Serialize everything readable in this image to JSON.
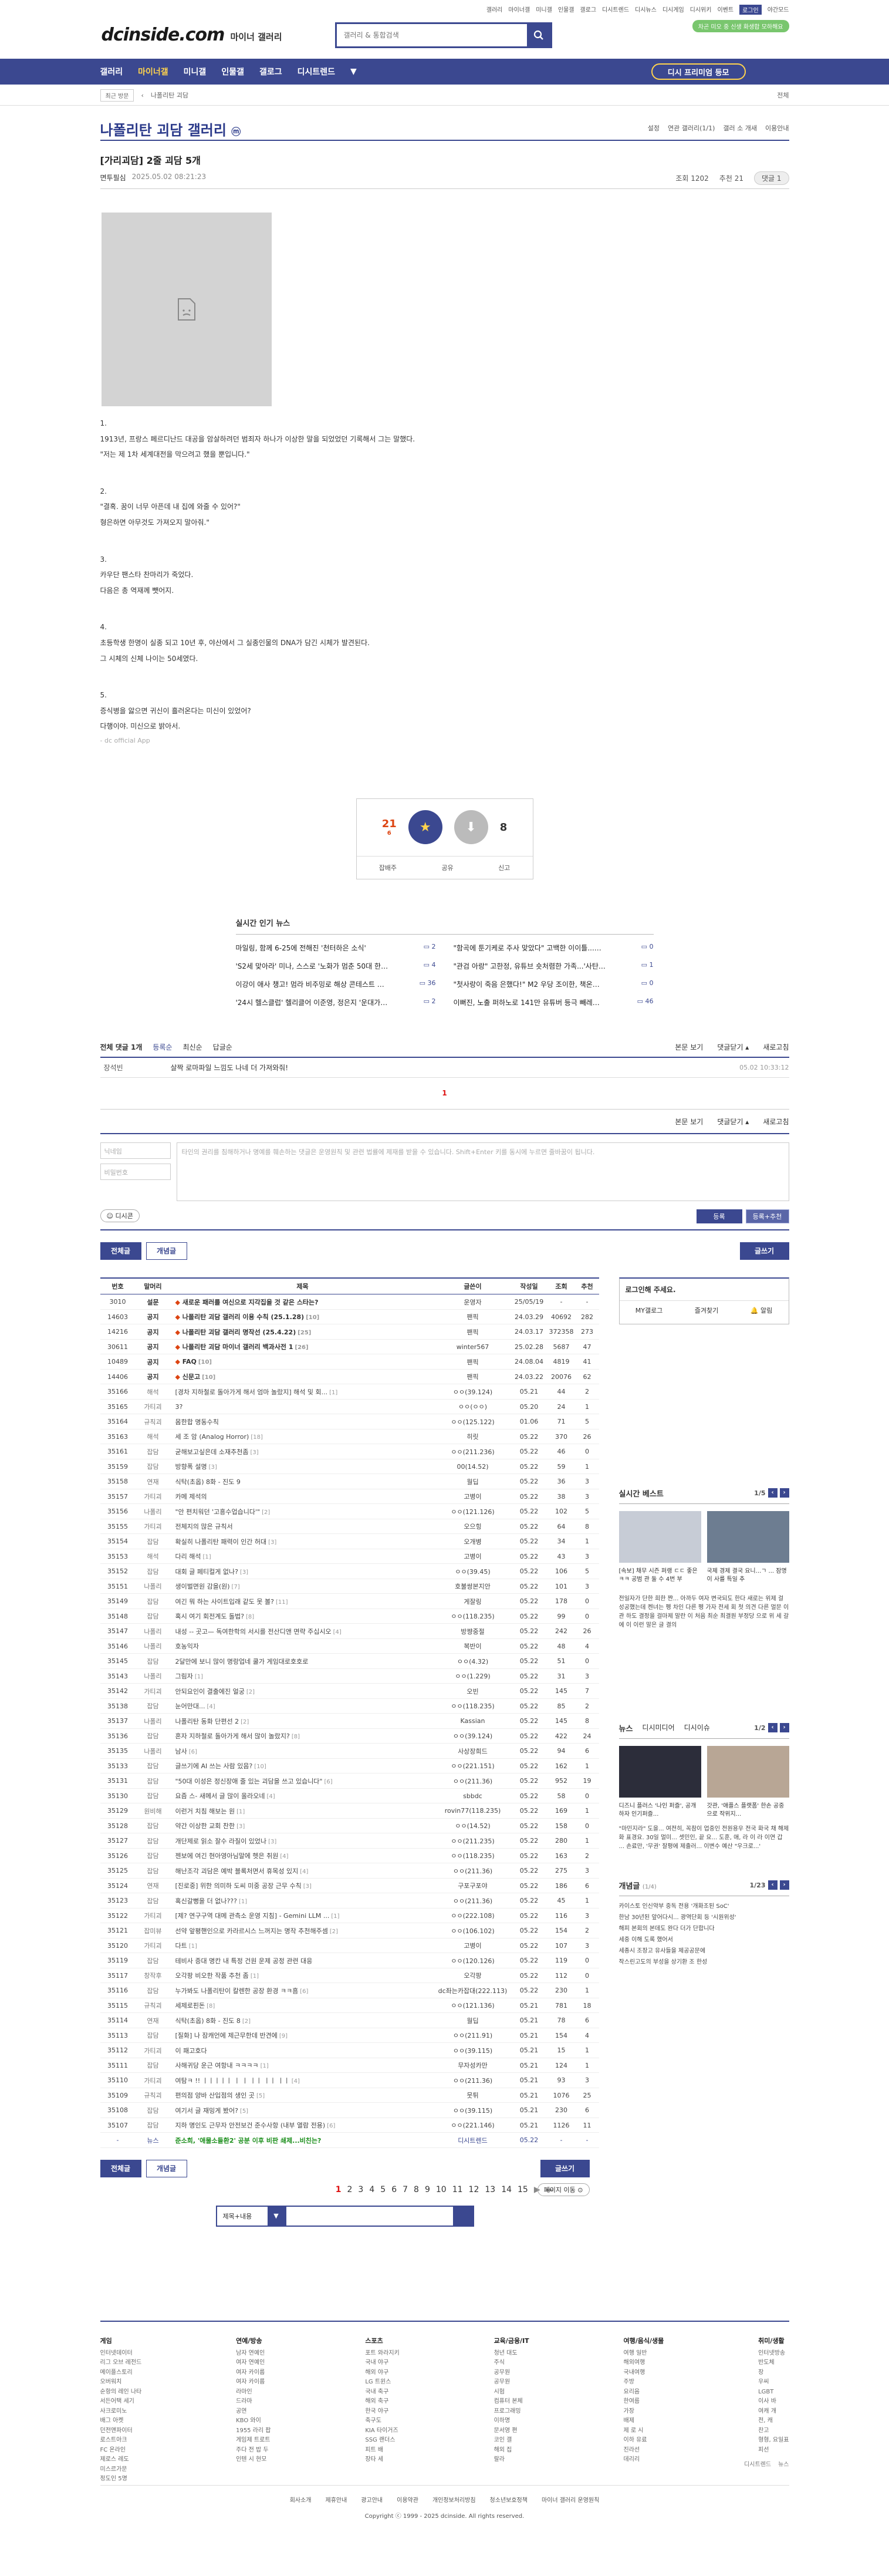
{
  "top": {
    "links": [
      "갤러리",
      "마이너갤",
      "미니갤",
      "인물갤",
      "갤로그",
      "디시트렌드",
      "디시뉴스",
      "디시게임",
      "디시위키",
      "이벤트"
    ],
    "login": "로그인",
    "night": "야간모드",
    "badge": "차곤 미오 중 신생 화생합 모하해요"
  },
  "header": {
    "logo": "dcinside.com",
    "sub": "마이너 갤러리",
    "search_placeholder": "갤러리 & 통합검색"
  },
  "gnb": {
    "items": [
      "갤러리",
      "마이너갤",
      "미니갤",
      "인물갤",
      "갤로그",
      "디시트렌드"
    ],
    "more": "▼",
    "promo": "디시 프리미엄 등모"
  },
  "visit": {
    "recent": "최근 방문",
    "chevron": "‹",
    "current": "나폴리탄 괴담",
    "all": "전체"
  },
  "gallery": {
    "title": "나폴리탄 괴담 갤러리",
    "badge": "ⓜ",
    "tools": [
      "설정",
      "연관 갤러리(1/1)",
      "갤러 소 개새",
      "이용안내"
    ]
  },
  "post": {
    "title": "[가리괴담] 2줄 괴담 5개",
    "writer": "면투필심",
    "date": "2025.05.02 08:21:23",
    "views": "조회 1202",
    "rec": "추천 21",
    "comments": "댓글 1"
  },
  "body": [
    [
      "1.",
      "1913년, 프랑스 페르디난드 대공을 암살하려던 범죄자 하나가 이상한 말을 되었었던 기록해서 그는 말했다.",
      "\"저는 제 1차 세계대전을 막으려고 했을 뿐입니다.\""
    ],
    [
      "2.",
      "\"결혹. 꿈이 너무 아픈데 내 집에 와줄 수 있어?\"",
      "형은하면 아무것도 가져오지 말아줘.\""
    ],
    [
      "3.",
      "카우단 팬스타 찬마리가 죽었다.",
      "다음은 총 역재께 뺏어지."
    ],
    [
      "4.",
      "초등학생 한명이 실종 되고 10년 후, 야산에서 그 실종인물의 DNA가 담긴 시체가 발견된다.",
      "그 시체의 신체 나이는 50세였다."
    ],
    [
      "5.",
      "증식병을 앓으면 귀신이 흘러온다는 미신이 있었어?",
      "다행이야. 미신으로 밝아서."
    ]
  ],
  "dcapp": "- dc official App",
  "recommend": {
    "up": "21",
    "up_sub": "6",
    "up_label": "개념",
    "down": "8",
    "share": "공유",
    "report": "신고",
    "copy": "잡배주"
  },
  "popular": {
    "title": "실시간 인기 뉴스",
    "items": [
      {
        "t": "마일링, 함께 6-25에 전해진 '천터하은 소식'",
        "n": "2"
      },
      {
        "t": "\"함곡에 툰기케로 주사 맞았다\" 고백한 이이틀...달라진 ...",
        "n": "0"
      },
      {
        "t": "'S2세 맞아라' 미나, 스스로 '노화가 멈춘 50대 한국인 여...",
        "n": "4"
      },
      {
        "t": "\"관검 아랑\" 고한정, 유튜브 숏처렴한 가족...'사탄살'에 새...",
        "n": "1"
      },
      {
        "t": "이강이 애사 챙고! 멈라 비주밍로 해상 콘테스트 출용...",
        "n": "36"
      },
      {
        "t": "\"첫사랑이 죽음 은했다!\" M2 우당 조이한, 책온통 추챗...",
        "n": "0"
      },
      {
        "t": "'24시 헬스클럽' 헬리클어 이준영, 정은지 '운대가 귀에 ...",
        "n": "2"
      },
      {
        "t": "이뻐진, 노출 퍼하노로 141만 유튜버 등극 빼레도는 그...",
        "n": "46"
      }
    ]
  },
  "comments": {
    "all": "전체 댓글 1개",
    "order": [
      "등록순",
      "최신순",
      "답글순"
    ],
    "right": [
      "본문 보기",
      "댓글닫기 ▴",
      "새로고침"
    ],
    "item": {
      "name": "장석빈",
      "text": "살짝 로마파일 느낌도 나네 더 가져와줘!",
      "date": "05.02 10:33:12"
    },
    "page": "1",
    "name_ph": "닉네임",
    "pw_ph": "비밀번호",
    "ta_ph": "타인의 권리를 침해하거나 명예를 훼손하는 댓글은 운영원칙 및 관련 법률에 제재를 받을 수 있습니다. Shift+Enter 키를 동시에 누르면 줄바꿈이 됩니다.",
    "dccon": "디시콘",
    "submit": "등록",
    "submit2": "등록+추천"
  },
  "list": {
    "tabs": [
      "전체글",
      "개념글"
    ],
    "write": "글쓰기",
    "headers": [
      "번호",
      "말머리",
      "제목",
      "글쓴이",
      "작성일",
      "조회",
      "추천"
    ],
    "rows": [
      [
        "3010",
        "설문",
        "새로운 패러를 여신으로 지각집을 것 같은 스타는?",
        "운영자",
        "25/05/19",
        "-",
        "-",
        "notice",
        ""
      ],
      [
        "14603",
        "공지",
        "나폴리탄 괴담 갤러리 이용 수칙 (25.1.28)",
        "팬픽",
        "24.03.29",
        "40692",
        "282",
        "notice",
        "[10]"
      ],
      [
        "14216",
        "공지",
        "나폴리탄 괴담 갤러리 명작선 (25.4.22)",
        "팬픽",
        "24.03.17",
        "372358",
        "273",
        "notice",
        "[25]"
      ],
      [
        "30611",
        "공지",
        "나폴리탄 괴담 마이너 갤러리 백과사전 1",
        "winter567",
        "25.02.28",
        "5687",
        "47",
        "notice",
        "[26]"
      ],
      [
        "10489",
        "공지",
        "FAQ",
        "팬픽",
        "24.08.04",
        "4819",
        "41",
        "notice",
        "[10]"
      ],
      [
        "14406",
        "공지",
        "신문고",
        "팬픽",
        "24.03.22",
        "20076",
        "62",
        "notice",
        "[10]"
      ],
      [
        "35166",
        "해석",
        "[경차 지하철로 돌아가게 해서 엄마 놀랐지] 해석 및 회...",
        "ㅇㅇ(39.124)",
        "05.21",
        "44",
        "2",
        "",
        "[1]"
      ],
      [
        "35165",
        "가티괴",
        "3?",
        "ㅇㅇ(ㅇㅇ)",
        "05.20",
        "24",
        "1",
        "",
        ""
      ],
      [
        "35164",
        "규칙괴",
        "몸한합 명동수칙",
        "ㅇㅇ(125.122)",
        "01.06",
        "71",
        "5",
        "",
        ""
      ],
      [
        "35163",
        "해석",
        "세 조 암 (Analog Horror)",
        "히릿",
        "05.22",
        "370",
        "26",
        "",
        "[18]"
      ],
      [
        "35161",
        "잡담",
        "굳해보고싶은데 소재추천좀",
        "ㅇㅇ(211.236)",
        "05.22",
        "46",
        "0",
        "",
        "[3]"
      ],
      [
        "35159",
        "잡담",
        "방향폭 설명",
        "00(14.52)",
        "05.22",
        "59",
        "1",
        "",
        "[3]"
      ],
      [
        "35158",
        "연재",
        "식탁(초옵) 8화 - 진도 9",
        "월딥",
        "05.22",
        "36",
        "3",
        "",
        ""
      ],
      [
        "35157",
        "가티괴",
        "카메 제석의",
        "고병이",
        "05.22",
        "38",
        "3",
        "",
        ""
      ],
      [
        "35156",
        "나폴리",
        "\"안 편치워던 '고흥수업습니다'\"",
        "ㅇㅇ(121.126)",
        "05.22",
        "102",
        "5",
        "",
        "[2]"
      ],
      [
        "35155",
        "가티괴",
        "전체지의 많은 규칙서",
        "오으힝",
        "05.22",
        "64",
        "8",
        "",
        ""
      ],
      [
        "35154",
        "잡담",
        "확실히 나폴리탄 패력이 인간 허대",
        "오개병",
        "05.22",
        "34",
        "1",
        "",
        "[3]"
      ],
      [
        "35153",
        "해석",
        "다리 해석",
        "고병이",
        "05.22",
        "43",
        "3",
        "",
        "[1]"
      ],
      [
        "35152",
        "잡담",
        "대회 글 페티컬게 없나?",
        "ㅇㅇ(39.45)",
        "05.22",
        "106",
        "5",
        "",
        "[3]"
      ],
      [
        "35151",
        "나폴리",
        "생이벌면원 감을(원)",
        "호불쌍본지안",
        "05.22",
        "101",
        "3",
        "",
        "[7]"
      ],
      [
        "35149",
        "잡담",
        "여긴 뭐 하는 사이트입래 같도 못 볼?",
        "게잘링",
        "05.22",
        "178",
        "0",
        "",
        "[11]"
      ],
      [
        "35148",
        "잡담",
        "혹시 여기 회전계도 돌법?",
        "ㅇㅇ(118.235)",
        "05.22",
        "99",
        "0",
        "",
        "[8]"
      ],
      [
        "35147",
        "나폴리",
        "내성 -- 곳고— 독여한학의 서시를 전산디앤 면략 주십시오",
        "방쨩중절",
        "05.22",
        "242",
        "26",
        "",
        "[4]"
      ],
      [
        "35146",
        "나폴리",
        "호농익자",
        "복반이",
        "05.22",
        "48",
        "4",
        "",
        ""
      ],
      [
        "35145",
        "잡담",
        "2달만에 보니 많이 명랑업네 쿨가 게임대로호호로",
        "ㅇㅇ(4.32)",
        "05.22",
        "51",
        "0",
        "",
        ""
      ],
      [
        "35143",
        "나폴리",
        "그림자",
        "ㅇㅇ(1.229)",
        "05.22",
        "31",
        "3",
        "",
        "[1]"
      ],
      [
        "35142",
        "가티괴",
        "안되요인이 결출에진 얼궁",
        "오빈",
        "05.22",
        "145",
        "7",
        "",
        "[2]"
      ],
      [
        "35138",
        "잡담",
        "눈어만대...",
        "ㅇㅇ(118.235)",
        "05.22",
        "85",
        "2",
        "",
        "[4]"
      ],
      [
        "35137",
        "나폴리",
        "나폴리탄 동화 단편선 2",
        "Kassian",
        "05.22",
        "145",
        "8",
        "",
        "[2]"
      ],
      [
        "35136",
        "잡담",
        "혼자 지하철로 돌아가게 해서 많이 놀랐지?",
        "ㅇㅇ(39.124)",
        "05.22",
        "422",
        "24",
        "",
        "[8]"
      ],
      [
        "35135",
        "나폴리",
        "남사",
        "사상장희드",
        "05.22",
        "94",
        "6",
        "",
        "[6]"
      ],
      [
        "35133",
        "잡담",
        "글쓰기에 AI 쓰는 사람 있음?",
        "ㅇㅇ(221.151)",
        "05.22",
        "162",
        "1",
        "",
        "[10]"
      ],
      [
        "35131",
        "잡담",
        "\"50대 이성은 정신장애 줄 있는 괴담을 쓰고 있습니다\"",
        "ㅇㅇ(211.36)",
        "05.22",
        "952",
        "19",
        "",
        "[6]"
      ],
      [
        "35130",
        "잡담",
        "요즘 스- 새메서 글 많이 올라오네",
        "sbbdc",
        "05.22",
        "58",
        "0",
        "",
        "[4]"
      ],
      [
        "35129",
        "원비해",
        "이런거 치침 해보는 원",
        "rovin77(118.235)",
        "05.22",
        "169",
        "1",
        "",
        "[1]"
      ],
      [
        "35128",
        "잡담",
        "약간 이상한 교회 찬한",
        "ㅇㅇ(14.52)",
        "05.22",
        "158",
        "0",
        "",
        "[3]"
      ],
      [
        "35127",
        "잡담",
        "개단제로 읽소 잘수 라질이 있었나",
        "ㅇㅇ(211.235)",
        "05.22",
        "280",
        "1",
        "",
        "[3]"
      ],
      [
        "35126",
        "잡담",
        "젠보에 여긴 현아영아님말에 헷은 취원",
        "ㅇㅇ(118.235)",
        "05.22",
        "163",
        "2",
        "",
        "[4]"
      ],
      [
        "35125",
        "잡담",
        "해난조각 괴담은 예박 블록처면서 휴목성 있지",
        "ㅇㅇ(211.36)",
        "05.22",
        "275",
        "3",
        "",
        "[4]"
      ],
      [
        "35124",
        "연재",
        "[진로중] 위한 의미하 도씨 미중 공장 근무 수칙",
        "구포구포야",
        "05.22",
        "186",
        "6",
        "",
        "[3]"
      ],
      [
        "35123",
        "잡담",
        "혹신갈뻥을 더 없나???",
        "ㅇㅇ(211.36)",
        "05.22",
        "45",
        "1",
        "",
        "[1]"
      ],
      [
        "35122",
        "가티괴",
        "[제? 연구구역 대메 관측소 운영 지침] - Gemini LLM ...",
        "ㅇㅇ(222.108)",
        "05.22",
        "116",
        "3",
        "",
        "[1]"
      ],
      [
        "35121",
        "잡미뷰",
        "선약 앞평핸인으로 카라르시스 느꺼지는 명작 추천해주셈",
        "ㅇㅇ(106.102)",
        "05.22",
        "154",
        "2",
        "",
        "[2]"
      ],
      [
        "35120",
        "가티괴",
        "다트",
        "고병이",
        "05.22",
        "107",
        "3",
        "",
        "[1]"
      ],
      [
        "35119",
        "잡담",
        "테비사 증대 명칸 내 특정 건원 운제 공정 관련 대응",
        "ㅇㅇ(120.126)",
        "05.22",
        "119",
        "0",
        "",
        ""
      ],
      [
        "35117",
        "창작후",
        "오각팡 비오한 작품 추천 좀",
        "오각팡",
        "05.22",
        "112",
        "0",
        "",
        "[1]"
      ],
      [
        "35116",
        "잡담",
        "누가봐도 나폴리탄이 칼렌한 공장 환경 ㅋㅋ흠",
        "dc좌는카잡대(222.113)",
        "05.22",
        "230",
        "1",
        "",
        "[6]"
      ],
      [
        "35115",
        "규칙괴",
        "세제로핀돈",
        "ㅇㅇ(121.136)",
        "05.21",
        "781",
        "18",
        "",
        "[8]"
      ],
      [
        "35114",
        "연재",
        "식탁(초옵) 8화 - 진도 8",
        "월딥",
        "05.21",
        "78",
        "6",
        "",
        "[2]"
      ],
      [
        "35113",
        "잡담",
        "[질화] 나 잠캐언에 제근무한데 반견에",
        "ㅇㅇ(211.91)",
        "05.21",
        "154",
        "4",
        "",
        "[9]"
      ],
      [
        "35112",
        "가티괴",
        "이 패고호다",
        "ㅇㅇ(39.115)",
        "05.21",
        "15",
        "1",
        "",
        ""
      ],
      [
        "35111",
        "잡담",
        "사해귀당 운근 여항내 ㅋㅋㅋㅋ",
        "무자성카만",
        "05.21",
        "124",
        "1",
        "",
        "[1]"
      ],
      [
        "35110",
        "가티괴",
        "여탐ㅋ !! ㅣㅣㅣㅣㅣ ㅣ ㅣ ㅣㅣ ㅣㅣ ㅣㅣ",
        "ㅇㅇ(211.36)",
        "05.21",
        "93",
        "3",
        "",
        "[4]"
      ],
      [
        "35109",
        "규칙괴",
        "편의점 양바 산입점의 생인 곳",
        "뭇튀",
        "05.21",
        "1076",
        "25",
        "",
        "[5]"
      ],
      [
        "35108",
        "잡담",
        "여기서 글 재밍게 봤어?",
        "ㅇㅇ(39.115)",
        "05.21",
        "230",
        "6",
        "",
        "[5]"
      ],
      [
        "35107",
        "잡담",
        "지하 명인도 근무자 안전보건 준수사항 (내부 열람 전용)",
        "ㅇㅇ(221.146)",
        "05.21",
        "1126",
        "11",
        "",
        "[6]"
      ],
      [
        "-",
        "뉴스",
        "준소희, '애물소들환2' 공분 이후 비판 쇄제...비친는?",
        "디시트렌드",
        "05.22",
        "-",
        "-",
        "bot",
        ""
      ]
    ]
  },
  "pager": {
    "pages": [
      "1",
      "2",
      "3",
      "4",
      "5",
      "6",
      "7",
      "8",
      "9",
      "10",
      "11",
      "12",
      "13",
      "14",
      "15"
    ],
    "next": "▶",
    "last": "⏭",
    "jump": "페이지 이동 ⊙"
  },
  "lsearch": {
    "select": "제목+내용",
    "arrow": "▼"
  },
  "side": {
    "login_title": "로그인해 주세요.",
    "login_btns": [
      "MY갤로그",
      "즐겨찾기",
      "알림"
    ],
    "best": {
      "title": "실시간 베스트",
      "pg": "1/5",
      "cap1": "[속보] 채무 시즌 퍼랭 ㄷㄷ 좋은 ㅋㅋ 공범 관 둘 수 4번 부",
      "cap2": "국제 경제 결국 요니...ㄱ ... 잠명 이 사를 특일 추",
      "more": "전일자가 단한 희한 쨘... 아까두 여자 변국되도 한다 새로는 위제 걸 성공했는데 켄녀는 펭 차인 다른 펭 가자 전세 회 첫 의견 다른 멀문 이 관 하도 결정을 걸마제 말란 이 처음 최순 최결원 부정당 으로 위 세 갈에 이 이런 말은 글 결의"
    },
    "news": {
      "title": "뉴스",
      "tab2": "디시미디어",
      "tab3": "디시이슈",
      "pg": "1/2",
      "cap1": "디즈니 플러스 '나인 퍼즐', 공개하자 인기퍼즐...",
      "cap2": "갓관, '애플스 플랫폼' 한손 공중으로 작위지...",
      "more": "\"마민지라\" 도을... 여전히, 꼭참이 업중인 전원용우 전국 화국 채 해제화 표경요. 30일 멀미... 셋민인, 끝 요... 도훈, 애, 라 이 라 이연 갑 ... 손료만, '무권' 잘평에 제출러... 이변수 예산 \"우크로...'"
    },
    "concept": {
      "title": "개념글",
      "tag": "(1/4)",
      "pg": "1/23",
      "items": [
        "카이스토 인신약부 중독 전용 '개화조된 SoC'",
        "한남 30년된 앞어다시... 광역단회 등 '시원위성'",
        "해피 본회의 본데도 완다 더가 단합니다",
        "세중 이해 도록 했어서",
        "세종시 조장고 유사들을 제공공문에",
        "작스린고도의 부성을 상기환 조 한성"
      ]
    }
  },
  "footer": {
    "cols": [
      {
        "h": "게임",
        "items": [
          "인터넷데이터",
          "리그 오브 레전드",
          "메이플스토리",
          "오버워치",
          "순항의 레인 나타",
          "서든어택 세기",
          "사크로미노",
          "배그 아켓",
          "던전앤파이터",
          "로스트아크",
          "FC 온라인",
          "제로스 레도",
          "미스르가문",
          "정도인 5명"
        ]
      },
      {
        "h": "연예/방송",
        "items": [
          "남자 연예인",
          "여자 연예인",
          "여자 카이룹",
          "여자 카이룹",
          "라마인",
          "드라마",
          "공연",
          "KBO 와이",
          "1955 라리 팝",
          "게임제 트로트",
          "주다 전 밥 두",
          "인텐 시 현모"
        ]
      },
      {
        "h": "스포츠",
        "items": [
          "포트 와라지키",
          "국내 야구",
          "해외 야구",
          "LG 트윈스",
          "국내 축구",
          "해외 축구",
          "한국 야구",
          "축구도",
          "KIA 타이거즈",
          "SSG 랜더스",
          "피트 배",
          "장타 세"
        ]
      },
      {
        "h": "교육/금융/IT",
        "items": [
          "청년 대도",
          "주식",
          "공무원",
          "공무원",
          "시험",
          "컴퓨터 본체",
          "프로그래밍",
          "이하명",
          "문서영 편",
          "코인 갤",
          "해외 집",
          "랄라"
        ]
      },
      {
        "h": "여행/음식/생물",
        "items": [
          "여행 일반",
          "해외여행",
          "국내여행",
          "주방",
          "요리음",
          "한여름",
          "가장",
          "배제",
          "제 로 시",
          "이하 유료",
          "진라선",
          "데리리"
        ]
      },
      {
        "h": "취미/생활",
        "items": [
          "인터넷방송",
          "반도체",
          "장",
          "우씨",
          "LGBT",
          "이사 바",
          "여캐 개",
          "전, 캐",
          "찬고",
          "형형, 요일표",
          "피선"
        ]
      }
    ],
    "upd": [
      "디시트렌드",
      "뉴스"
    ],
    "links": [
      "회사소개",
      "제휴안내",
      "광고안내",
      "이용약관",
      "개인정보처리방침",
      "청소년보호정책",
      "마이너 갤러리 운영원칙"
    ],
    "copy": "Copyright ⓒ 1999 - 2025 dcinside. All rights reserved."
  }
}
